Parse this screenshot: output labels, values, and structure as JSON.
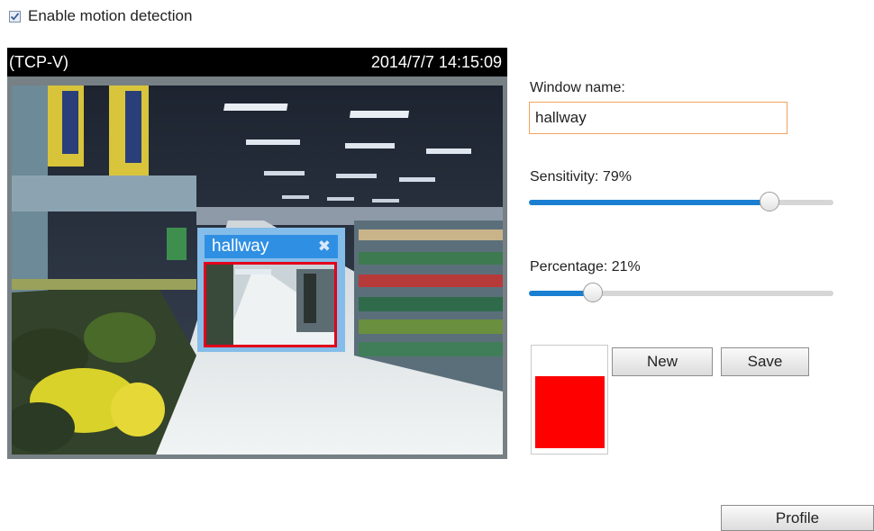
{
  "motion_detection": {
    "enable_label": "Enable motion detection",
    "enabled": true
  },
  "viewer": {
    "stream_label": "(TCP-V)",
    "timestamp": "2014/7/7 14:15:09"
  },
  "motion_window": {
    "title": "hallway",
    "close_icon": "close-icon"
  },
  "window_name": {
    "label": "Window name:",
    "value": "hallway"
  },
  "sensitivity": {
    "label": "Sensitivity: 79%",
    "value_percent": 79
  },
  "percentage": {
    "label": "Percentage: 21%",
    "value_percent": 21
  },
  "activity_level": {
    "fill_fraction": 0.73,
    "color": "#ff0000"
  },
  "buttons": {
    "new_label": "New",
    "save_label": "Save",
    "profile_label": "Profile"
  },
  "colors": {
    "accent": "#1a7fd0",
    "motion_window_header": "#2f8fe3",
    "motion_region_border": "#e3001b",
    "input_focus_border": "#f0a45d"
  }
}
